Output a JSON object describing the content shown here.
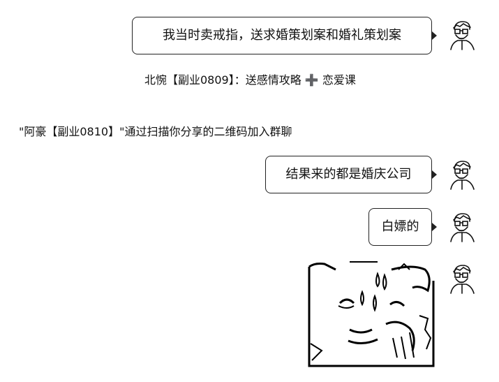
{
  "messages": [
    {
      "text": "我当时卖戒指，送求婚策划案和婚礼策划案"
    },
    {
      "text": "结果来的都是婚庆公司"
    },
    {
      "text": "白嫖的"
    }
  ],
  "system_notices": [
    {
      "text": "北惋【副业0809】：送感情攻略 ➕ 恋爱课"
    },
    {
      "text": "\"阿豪【副业0810】\"通过扫描你分享的二维码加入群聊"
    }
  ],
  "sticker": {
    "icon": "sweating-face-sticker"
  },
  "avatar": {
    "icon": "user-avatar-icon"
  }
}
